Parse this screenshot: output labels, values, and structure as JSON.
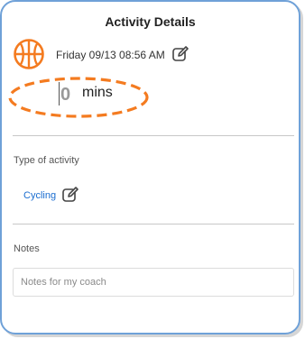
{
  "header": {
    "title": "Activity Details"
  },
  "activity": {
    "icon": "basketball-icon",
    "datetime": "Friday 09/13 08:56 AM",
    "duration_value": "0",
    "duration_unit": "mins",
    "type_label": "Type of activity",
    "type_value": "Cycling"
  },
  "notes": {
    "label": "Notes",
    "placeholder": "Notes for my coach",
    "value": ""
  },
  "colors": {
    "accent": "#f47b20",
    "link": "#1a6dd0",
    "card_border": "#6fa1d8",
    "annotation": "#f47b20"
  }
}
